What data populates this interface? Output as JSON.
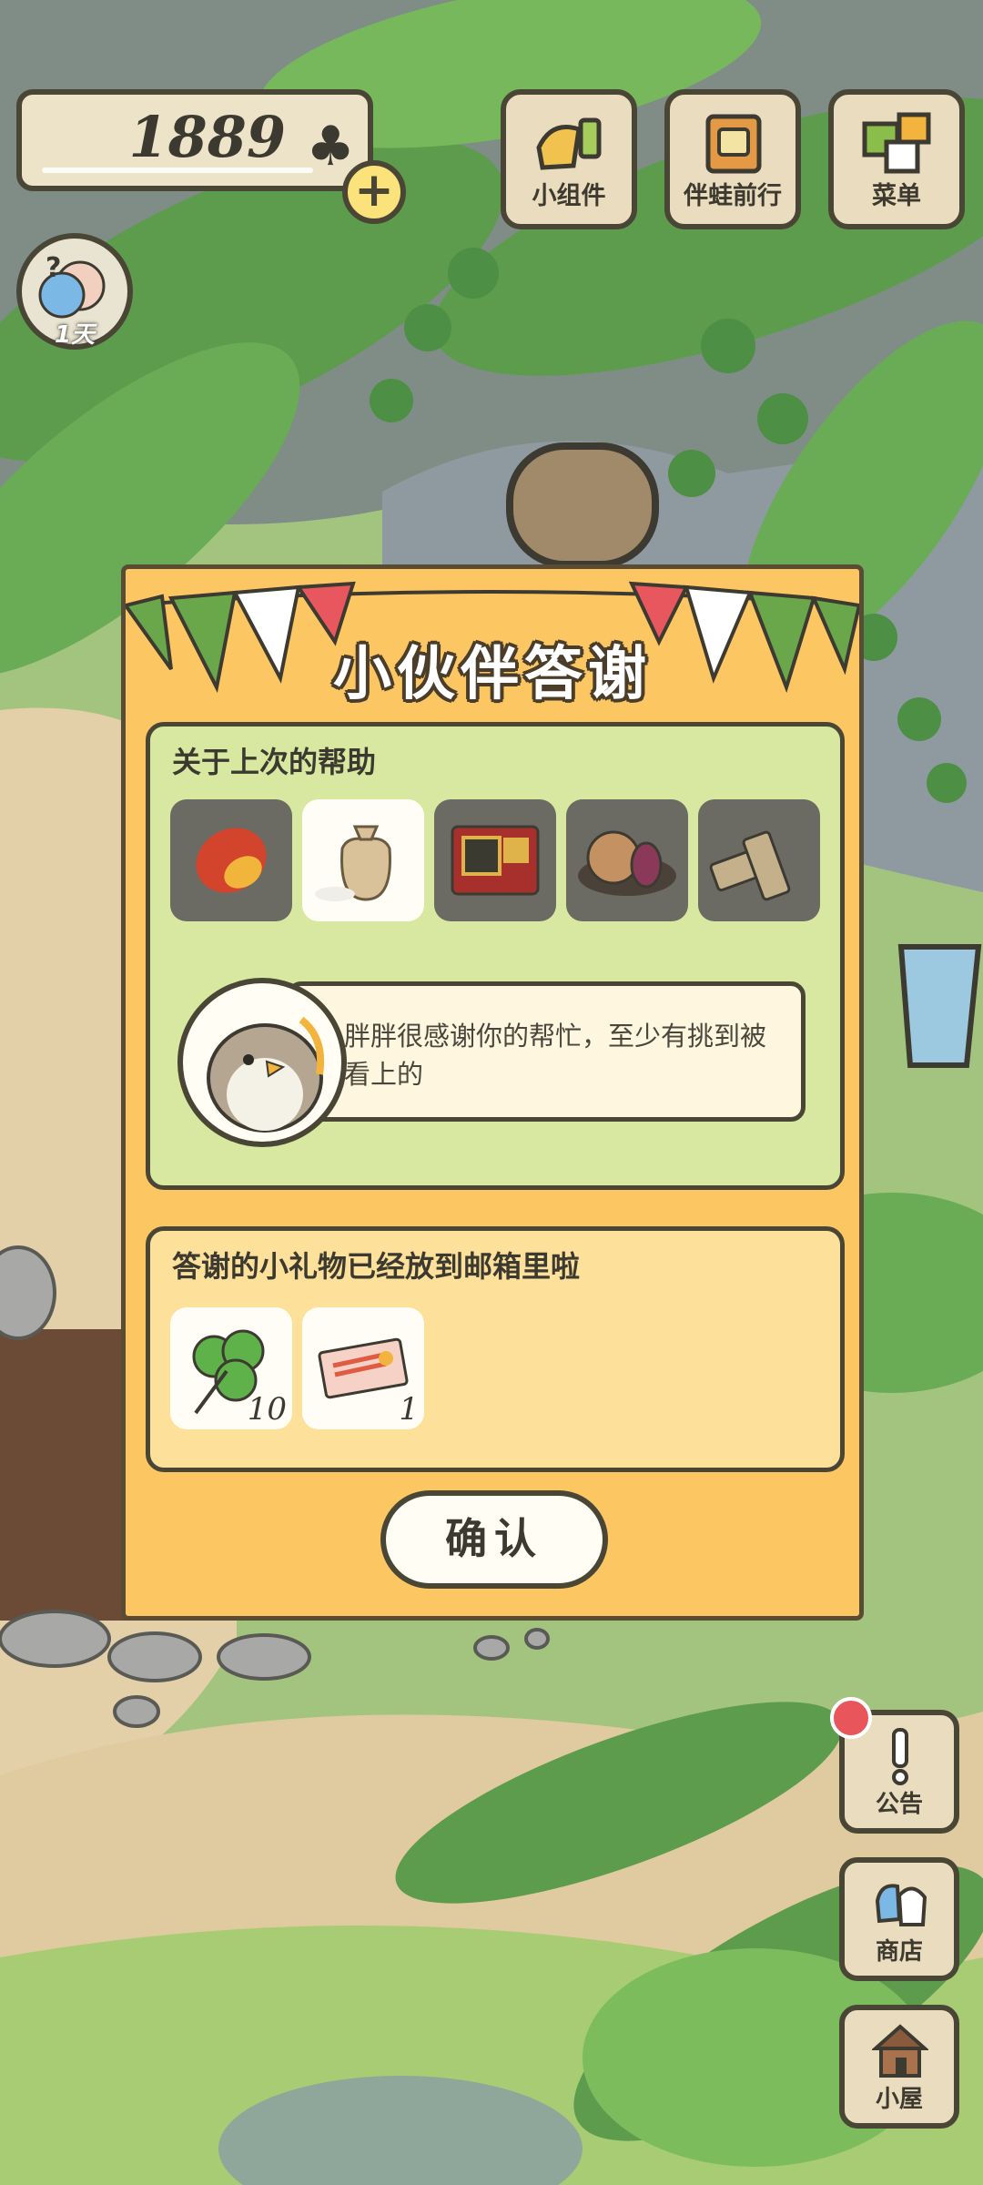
{
  "hud": {
    "clover_count": "1889",
    "clover_icon": "clover-icon",
    "plus_symbol": "+",
    "day_label": "1天"
  },
  "top_buttons": [
    {
      "label": "小组件",
      "icon": "widget-icon"
    },
    {
      "label": "伴蛙前行",
      "icon": "frog-travel-icon"
    },
    {
      "label": "菜单",
      "icon": "menu-icon"
    }
  ],
  "dialog": {
    "title": "小伙伴答谢",
    "help_heading": "关于上次的帮助",
    "items": [
      {
        "name": "mango",
        "icon": "mango-icon"
      },
      {
        "name": "rice-sack",
        "icon": "rice-sack-icon"
      },
      {
        "name": "gift-box",
        "icon": "gift-box-icon"
      },
      {
        "name": "pastry",
        "icon": "pastry-icon"
      },
      {
        "name": "crackers",
        "icon": "cracker-icon"
      }
    ],
    "message": "胖胖很感谢你的帮忙，至少有挑到被看上的",
    "gift_heading": "答谢的小礼物已经放到邮箱里啦",
    "gifts": [
      {
        "icon": "clover-icon",
        "qty": "10"
      },
      {
        "icon": "ticket-icon",
        "qty": "1"
      }
    ],
    "confirm_label": "确认"
  },
  "side_buttons": [
    {
      "label": "公告",
      "icon": "notice-icon"
    },
    {
      "label": "商店",
      "icon": "shop-icon"
    },
    {
      "label": "小屋",
      "icon": "house-icon"
    }
  ],
  "colors": {
    "dialog_bg": "#fcc762",
    "panel_green": "#d8e8a0",
    "panel_yellow": "#fde09a",
    "outline": "#4a4636",
    "notice_dot": "#e8555a"
  }
}
